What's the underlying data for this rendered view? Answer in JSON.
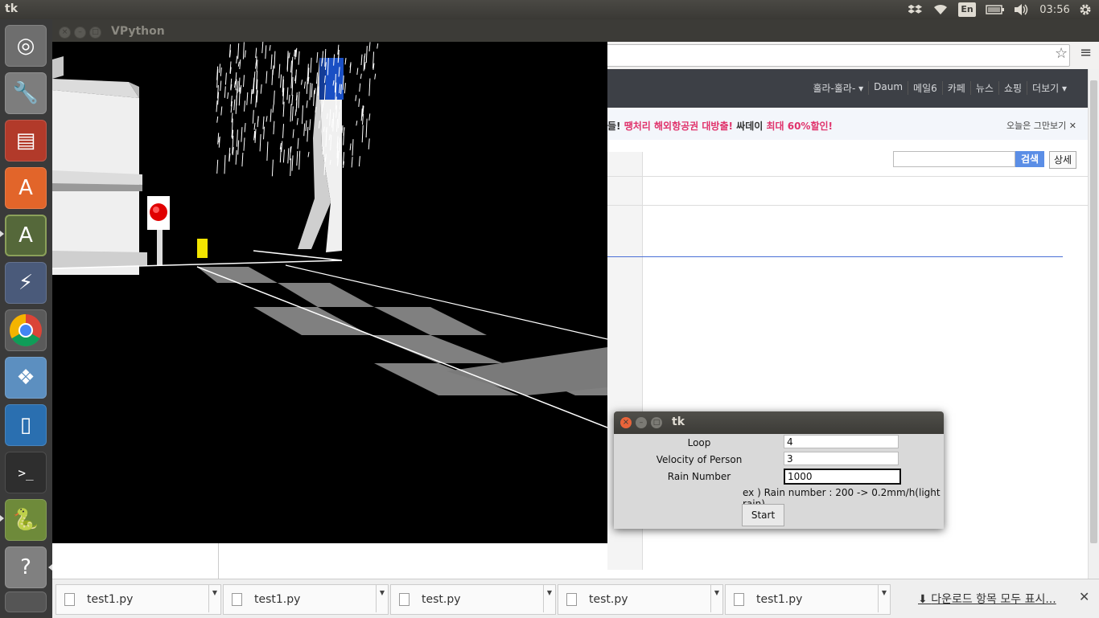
{
  "topbar": {
    "app_title": "tk",
    "keyboard_layout": "En",
    "time": "03:56"
  },
  "launcher": {
    "items": [
      {
        "name": "ubuntu-dash",
        "color": "#7a7a7a"
      },
      {
        "name": "system-settings",
        "color": "#8a8a8a"
      },
      {
        "name": "file-manager",
        "color": "#b23a2a"
      },
      {
        "name": "software-center",
        "color": "#e2652a"
      },
      {
        "name": "software-updater",
        "color": "#5a6a3a"
      },
      {
        "name": "remote-desktop",
        "color": "#4a5a7a"
      },
      {
        "name": "chrome",
        "color": "#2f6cd1"
      },
      {
        "name": "dropbox",
        "color": "#3d8ee0"
      },
      {
        "name": "text-editor",
        "color": "#2a6fb0"
      },
      {
        "name": "terminal",
        "color": "#3a3a3a"
      },
      {
        "name": "python-idle",
        "color": "#7a9a3a"
      },
      {
        "name": "help",
        "color": "#8a8a8a"
      },
      {
        "name": "trash",
        "color": "#6a6a6a"
      }
    ]
  },
  "browser": {
    "daum_nav": [
      "훌라-훌라- ▾",
      "Daum",
      "메일6",
      "카페",
      "뉴스",
      "쇼핑",
      "더보기 ▾"
    ],
    "ad_prefix": "들! ",
    "ad_pink1": "땡처리 해외항공권 대방출!",
    "ad_dark": " 싸데이 ",
    "ad_pink2": "최대 60%할인!",
    "ad_close": "오늘은 그만보기 ✕",
    "search_button": "검색",
    "detail_button": "상세"
  },
  "downloads": {
    "items": [
      {
        "filename": "test1.py"
      },
      {
        "filename": "test1.py"
      },
      {
        "filename": "test.py"
      },
      {
        "filename": "test.py"
      },
      {
        "filename": "test1.py"
      }
    ],
    "show_all": "다운로드 항목 모두 표시...",
    "close": "✕"
  },
  "vpython": {
    "title": "VPython"
  },
  "tk": {
    "title": "tk",
    "loop_label": "Loop",
    "loop_value": "4",
    "velocity_label": "Velocity of Person",
    "velocity_value": "3",
    "rain_label": "Rain Number",
    "rain_value": "1000",
    "example_text": "ex ) Rain number : 200 -> 0.2mm/h(light rain)",
    "start_label": "Start"
  }
}
